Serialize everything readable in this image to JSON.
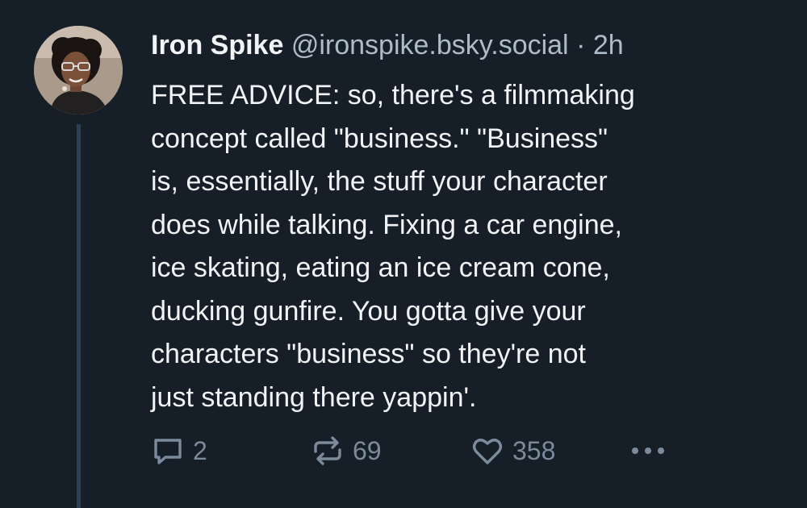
{
  "post": {
    "author": {
      "name": "Iron Spike",
      "handle": "@ironspike.bsky.social",
      "separator": "·",
      "time": "2h"
    },
    "text": "FREE ADVICE: so, there's a filmmaking\nconcept called \"business.\" \"Business\"\nis, essentially, the stuff your character\ndoes while talking. Fixing a car engine,\nice skating, eating an ice cream cone,\nducking gunfire. You gotta give your\ncharacters \"business\" so they're not\njust standing there yappin'.",
    "actions": {
      "reply_count": "2",
      "repost_count": "69",
      "like_count": "358"
    }
  },
  "icons": {
    "reply": "speech-bubble-icon",
    "repost": "repost-arrows-icon",
    "like": "heart-icon",
    "more": "ellipsis-icon"
  },
  "colors": {
    "background": "#161e27",
    "text": "#f1f3f5",
    "muted": "#7c8b9b",
    "handle": "#aebbc9",
    "thread_line": "#2d3f55"
  }
}
